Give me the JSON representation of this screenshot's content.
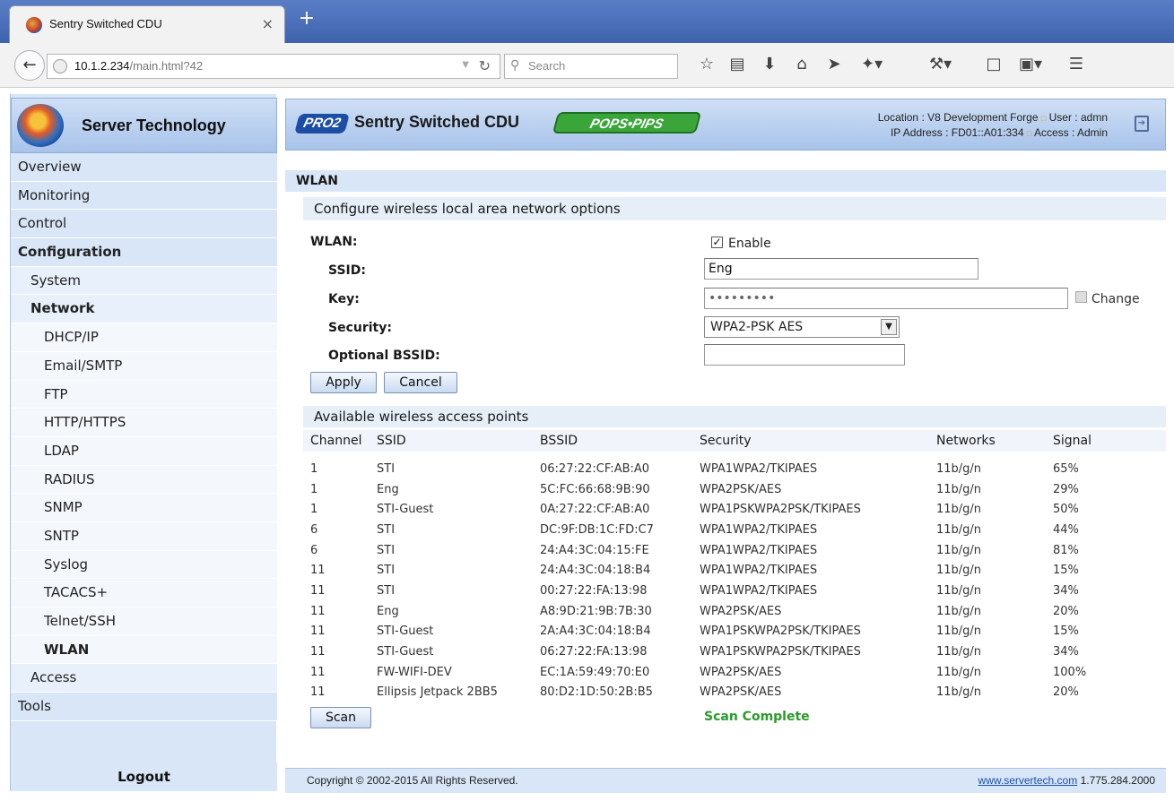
{
  "browser": {
    "tab_title": "Sentry Switched CDU",
    "tab_close": "×",
    "new_tab": "+",
    "url_host": "10.1.2.234",
    "url_path": "/main.html?42",
    "search_placeholder": "Search",
    "icons": [
      "back-arrow-icon",
      "reload-icon",
      "star-icon",
      "reading-list-icon",
      "download-icon",
      "home-icon",
      "send-icon",
      "extension-icon",
      "tools-icon",
      "window-icon",
      "screenshot-icon",
      "hamburger-menu-icon"
    ]
  },
  "sidebar": {
    "brand": "Server Technology",
    "items": [
      {
        "label": "Overview",
        "level": 0,
        "bold": false
      },
      {
        "label": "Monitoring",
        "level": 0,
        "bold": false
      },
      {
        "label": "Control",
        "level": 0,
        "bold": false
      },
      {
        "label": "Configuration",
        "level": 0,
        "bold": true
      },
      {
        "label": "System",
        "level": 1,
        "bold": false
      },
      {
        "label": "Network",
        "level": 1,
        "bold": true
      },
      {
        "label": "DHCP/IP",
        "level": 2,
        "bold": false
      },
      {
        "label": "Email/SMTP",
        "level": 2,
        "bold": false
      },
      {
        "label": "FTP",
        "level": 2,
        "bold": false
      },
      {
        "label": "HTTP/HTTPS",
        "level": 2,
        "bold": false
      },
      {
        "label": "LDAP",
        "level": 2,
        "bold": false
      },
      {
        "label": "RADIUS",
        "level": 2,
        "bold": false
      },
      {
        "label": "SNMP",
        "level": 2,
        "bold": false
      },
      {
        "label": "SNTP",
        "level": 2,
        "bold": false
      },
      {
        "label": "Syslog",
        "level": 2,
        "bold": false
      },
      {
        "label": "TACACS+",
        "level": 2,
        "bold": false
      },
      {
        "label": "Telnet/SSH",
        "level": 2,
        "bold": false
      },
      {
        "label": "WLAN",
        "level": 2,
        "bold": true
      },
      {
        "label": "Access",
        "level": 1,
        "bold": false
      },
      {
        "label": "Tools",
        "level": 0,
        "bold": false
      }
    ],
    "logout": "Logout"
  },
  "header": {
    "pro_badge": "PRO2",
    "product": "Sentry Switched CDU",
    "pops_badge": "POPS•PIPS",
    "location_line": "Location : V8 Development Forge",
    "user_line": "User : admn",
    "ip_line": "IP Address : FD01::A01:334",
    "access_line": "Access : Admin",
    "separator": "□"
  },
  "wlan": {
    "section_title": "WLAN",
    "subtitle": "Configure wireless local area network options",
    "wlan_label": "WLAN:",
    "enable_label": "Enable",
    "enable_checked": true,
    "ssid_label": "SSID:",
    "ssid_value": "Eng",
    "key_label": "Key:",
    "key_value": "•••••••••",
    "change_label": "Change",
    "security_label": "Security:",
    "security_value": "WPA2-PSK AES",
    "bssid_label": "Optional BSSID:",
    "bssid_value": "",
    "apply_label": "Apply",
    "cancel_label": "Cancel"
  },
  "access_points": {
    "title": "Available wireless access points",
    "columns": [
      "Channel",
      "SSID",
      "BSSID",
      "Security",
      "Networks",
      "Signal"
    ],
    "rows": [
      [
        "1",
        "STI",
        "06:27:22:CF:AB:A0",
        "WPA1WPA2/TKIPAES",
        "11b/g/n",
        "65%"
      ],
      [
        "1",
        "Eng",
        "5C:FC:66:68:9B:90",
        "WPA2PSK/AES",
        "11b/g/n",
        "29%"
      ],
      [
        "1",
        "STI-Guest",
        "0A:27:22:CF:AB:A0",
        "WPA1PSKWPA2PSK/TKIPAES",
        "11b/g/n",
        "50%"
      ],
      [
        "6",
        "STI",
        "DC:9F:DB:1C:FD:C7",
        "WPA1WPA2/TKIPAES",
        "11b/g/n",
        "44%"
      ],
      [
        "6",
        "STI",
        "24:A4:3C:04:15:FE",
        "WPA1WPA2/TKIPAES",
        "11b/g/n",
        "81%"
      ],
      [
        "11",
        "STI",
        "24:A4:3C:04:18:B4",
        "WPA1WPA2/TKIPAES",
        "11b/g/n",
        "15%"
      ],
      [
        "11",
        "STI",
        "00:27:22:FA:13:98",
        "WPA1WPA2/TKIPAES",
        "11b/g/n",
        "34%"
      ],
      [
        "11",
        "Eng",
        "A8:9D:21:9B:7B:30",
        "WPA2PSK/AES",
        "11b/g/n",
        "20%"
      ],
      [
        "11",
        "STI-Guest",
        "2A:A4:3C:04:18:B4",
        "WPA1PSKWPA2PSK/TKIPAES",
        "11b/g/n",
        "15%"
      ],
      [
        "11",
        "STI-Guest",
        "06:27:22:FA:13:98",
        "WPA1PSKWPA2PSK/TKIPAES",
        "11b/g/n",
        "34%"
      ],
      [
        "11",
        "FW-WIFI-DEV",
        "EC:1A:59:49:70:E0",
        "WPA2PSK/AES",
        "11b/g/n",
        "100%"
      ],
      [
        "11",
        "Ellipsis Jetpack 2BB5",
        "80:D2:1D:50:2B:B5",
        "WPA2PSK/AES",
        "11b/g/n",
        "20%"
      ]
    ],
    "scan_label": "Scan",
    "scan_status": "Scan Complete"
  },
  "footer": {
    "copyright": "Copyright © 2002-2015 All Rights Reserved.",
    "website": "www.servertech.com",
    "phone": "1.775.284.2000"
  },
  "colors": {
    "sidebar_bg": "#d8e6f7",
    "header_gradient_top": "#cfdff5",
    "header_gradient_bottom": "#a8c3ea",
    "scan_status": "#2b9a2b",
    "link": "#1a4fb0",
    "browser_tabbar": "#4a6fb9"
  }
}
